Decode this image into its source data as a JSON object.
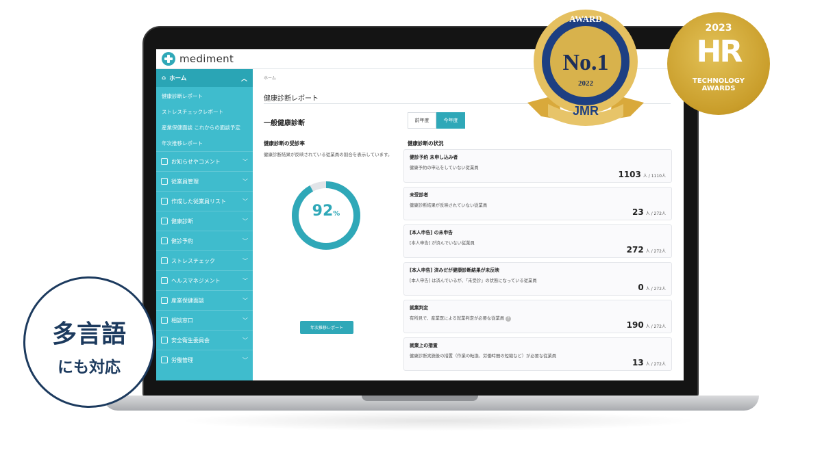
{
  "app": {
    "logo_text": "mediment"
  },
  "sidebar": {
    "home_label": "ホーム",
    "subitems": [
      "健康診断レポート",
      "ストレスチェックレポート",
      "産業保健面談 これからの面談予定",
      "年次推移レポート"
    ],
    "items": [
      "お知らせやコメント",
      "従業員管理",
      "作成した従業員リスト",
      "健康診断",
      "健診予約",
      "ストレスチェック",
      "ヘルスマネジメント",
      "産業保健面談",
      "相談窓口",
      "安全衛生委員会",
      "労働管理"
    ]
  },
  "main": {
    "breadcrumb": "ホーム",
    "page_title": "健康診断レポート",
    "section_title": "一般健康診断",
    "year_tabs": [
      "前年度",
      "今年度"
    ],
    "rate": {
      "title": "健康診断の受診率",
      "desc": "健康診断結果が反映されている従業員の割合を表示しています。",
      "value": "92",
      "unit": "%",
      "fraction": 0.92,
      "button": "年次推移レポート"
    },
    "status": {
      "title": "健康診断の状況",
      "cards": [
        {
          "title": "健診予約 未申し込み者",
          "desc": "健康予約の申込をしていない従業員",
          "count": "1103",
          "total": "人 / 1110人"
        },
        {
          "title": "未受診者",
          "desc": "健康診断結果が反映されていない従業員",
          "count": "23",
          "total": "人 / 272人"
        },
        {
          "title": "[本人申告] の未申告",
          "desc": "[本人申告] が済んでいない従業員",
          "count": "272",
          "total": "人 / 272人"
        },
        {
          "title": "[本人申告] 済みだが健康診断結果が未反映",
          "desc": "[本人申告] は済んでいるが、「未受診」の状態になっている従業員",
          "count": "0",
          "total": "人 / 272人"
        },
        {
          "title": "就業判定",
          "desc": "有所見で、産業医による就業判定が必要な従業員",
          "count": "190",
          "total": "人 / 272人"
        },
        {
          "title": "就業上の措置",
          "desc": "健康診断実施後の措置（作業の転換、労働時間の短縮など）が必要な従業員",
          "count": "13",
          "total": "人 / 272人"
        }
      ]
    }
  },
  "badges": {
    "award_top": "AWARD",
    "award_rank": "No.1",
    "award_year": "2022",
    "award_org": "JMR",
    "hr_year": "2023",
    "hr_mark": "HR",
    "hr_line1": "TECHNOLOGY",
    "hr_line2": "AWARDS"
  },
  "lang": {
    "line1": "多言語",
    "line2": "にも対応"
  },
  "colors": {
    "accent": "#2fa8b8",
    "sidebar": "#3fbccd",
    "navy": "#1c3a5e",
    "gold": "#c99d2a"
  }
}
